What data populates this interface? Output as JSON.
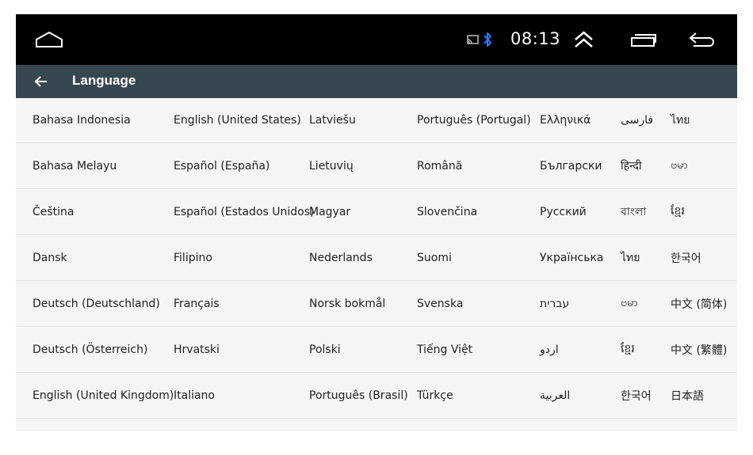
{
  "status_bar": {
    "time": "08:13",
    "icons": [
      "home-icon",
      "cast-icon",
      "bluetooth-icon",
      "expand-up-icon",
      "recent-apps-icon",
      "back-icon"
    ],
    "bluetooth_color": "#2979ff"
  },
  "app_bar": {
    "title": "Language",
    "back_icon": "arrow-left-icon",
    "background": "#37474f"
  },
  "languages": [
    [
      "Bahasa Indonesia",
      "English (United States)",
      "Latviešu",
      "Português (Portugal)",
      "Ελληνικά",
      "فارسی",
      "ไทย"
    ],
    [
      "Bahasa Melayu",
      "Español (España)",
      "Lietuvių",
      "Română",
      "Български",
      "हिन्दी",
      "ဗမာ"
    ],
    [
      "Čeština",
      "Español (Estados Unidos)",
      "Magyar",
      "Slovenčina",
      "Русский",
      "বাংলা",
      "ខ្មែរ"
    ],
    [
      "Dansk",
      "Filipino",
      "Nederlands",
      "Suomi",
      "Українська",
      "ไทย",
      "한국어"
    ],
    [
      "Deutsch (Deutschland)",
      "Français",
      "Norsk bokmål",
      "Svenska",
      "עברית",
      "ဗမာ",
      "中文 (简体)"
    ],
    [
      "Deutsch (Österreich)",
      "Hrvatski",
      "Polski",
      "Tiếng Việt",
      "اردو",
      "ខ្មែរ",
      "中文 (繁體)"
    ],
    [
      "English (United Kingdom)",
      "Italiano",
      "Português (Brasil)",
      "Türkçe",
      "العربية",
      "한국어",
      "日本語"
    ]
  ]
}
